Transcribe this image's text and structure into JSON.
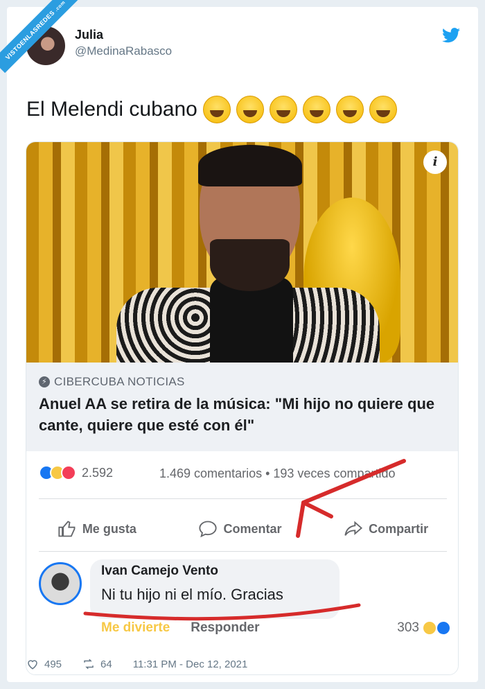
{
  "watermark": {
    "text": "VISTOENLASREDES",
    "sub": ".com"
  },
  "author": {
    "name": "Julia",
    "handle": "@MedinaRabasco"
  },
  "tweet": {
    "text": "El Melendi cubano",
    "emojis": [
      "laughing",
      "laughing",
      "laughing",
      "joy",
      "joy",
      "joy"
    ]
  },
  "embed": {
    "source": "CIBERCUBA NOTICIAS",
    "headline": "Anuel AA se retira de la música: \"Mi hijo no quiere que cante, quiere que esté con él\"",
    "info_icon": "i"
  },
  "facebook": {
    "reaction_count": "2.592",
    "stats": "1.469 comentarios • 193 veces compartido",
    "actions": {
      "like": "Me gusta",
      "comment": "Comentar",
      "share": "Compartir"
    },
    "comment": {
      "author": "Ivan Camejo Vento",
      "text": "Ni tu hijo ni el mío. Gracias",
      "react_label": "Me divierte",
      "reply_label": "Responder",
      "count": "303"
    }
  },
  "meta": {
    "likes": "495",
    "retweets": "64",
    "timestamp": "11:31 PM - Dec 12, 2021"
  },
  "colors": {
    "twitter_blue": "#1da1f2",
    "facebook_blue": "#1877f2",
    "annotation_red": "#d62b2b"
  }
}
